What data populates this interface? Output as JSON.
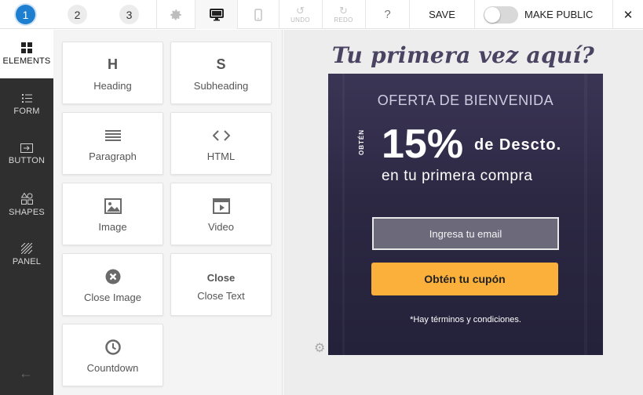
{
  "topbar": {
    "steps": [
      "1",
      "2",
      "3"
    ],
    "undo_label": "UNDO",
    "redo_label": "REDO",
    "help_label": "?",
    "save_label": "SAVE",
    "make_public_label": "MAKE PUBLIC",
    "make_public_on": false,
    "close_label": "✕"
  },
  "rail": {
    "items": [
      {
        "label": "ELEMENTS",
        "icon": "grid-icon",
        "active": true
      },
      {
        "label": "FORM",
        "icon": "form-icon",
        "active": false
      },
      {
        "label": "BUTTON",
        "icon": "button-icon",
        "active": false
      },
      {
        "label": "SHAPES",
        "icon": "shapes-icon",
        "active": false
      },
      {
        "label": "PANEL",
        "icon": "panel-icon",
        "active": false
      }
    ],
    "back_icon": "arrow-left-icon"
  },
  "elements": [
    {
      "name": "Heading",
      "icon": "H"
    },
    {
      "name": "Subheading",
      "icon": "S"
    },
    {
      "name": "Paragraph",
      "icon": "paragraph-icon"
    },
    {
      "name": "HTML",
      "icon": "code-icon"
    },
    {
      "name": "Image",
      "icon": "image-icon"
    },
    {
      "name": "Video",
      "icon": "video-icon"
    },
    {
      "name": "Close Image",
      "icon": "close-circle-icon"
    },
    {
      "name": "Close Text",
      "icon": "Close"
    },
    {
      "name": "Countdown",
      "icon": "clock-icon"
    }
  ],
  "canvas": {
    "headline": "Tu primera vez aquí?",
    "offer": "OFERTA DE BIENVENIDA",
    "obten": "OBTÉN",
    "percent": "15%",
    "descuento": "de Descto.",
    "first_purchase": "en tu primera compra",
    "email_placeholder": "Ingresa tu email",
    "cta_label": "Obtén tu cupón",
    "terms": "*Hay términos y condiciones."
  },
  "colors": {
    "accent": "#1e7fd0",
    "cta": "#fbb03b",
    "popup_bg": "#2c2843",
    "headline": "#4a4361"
  }
}
